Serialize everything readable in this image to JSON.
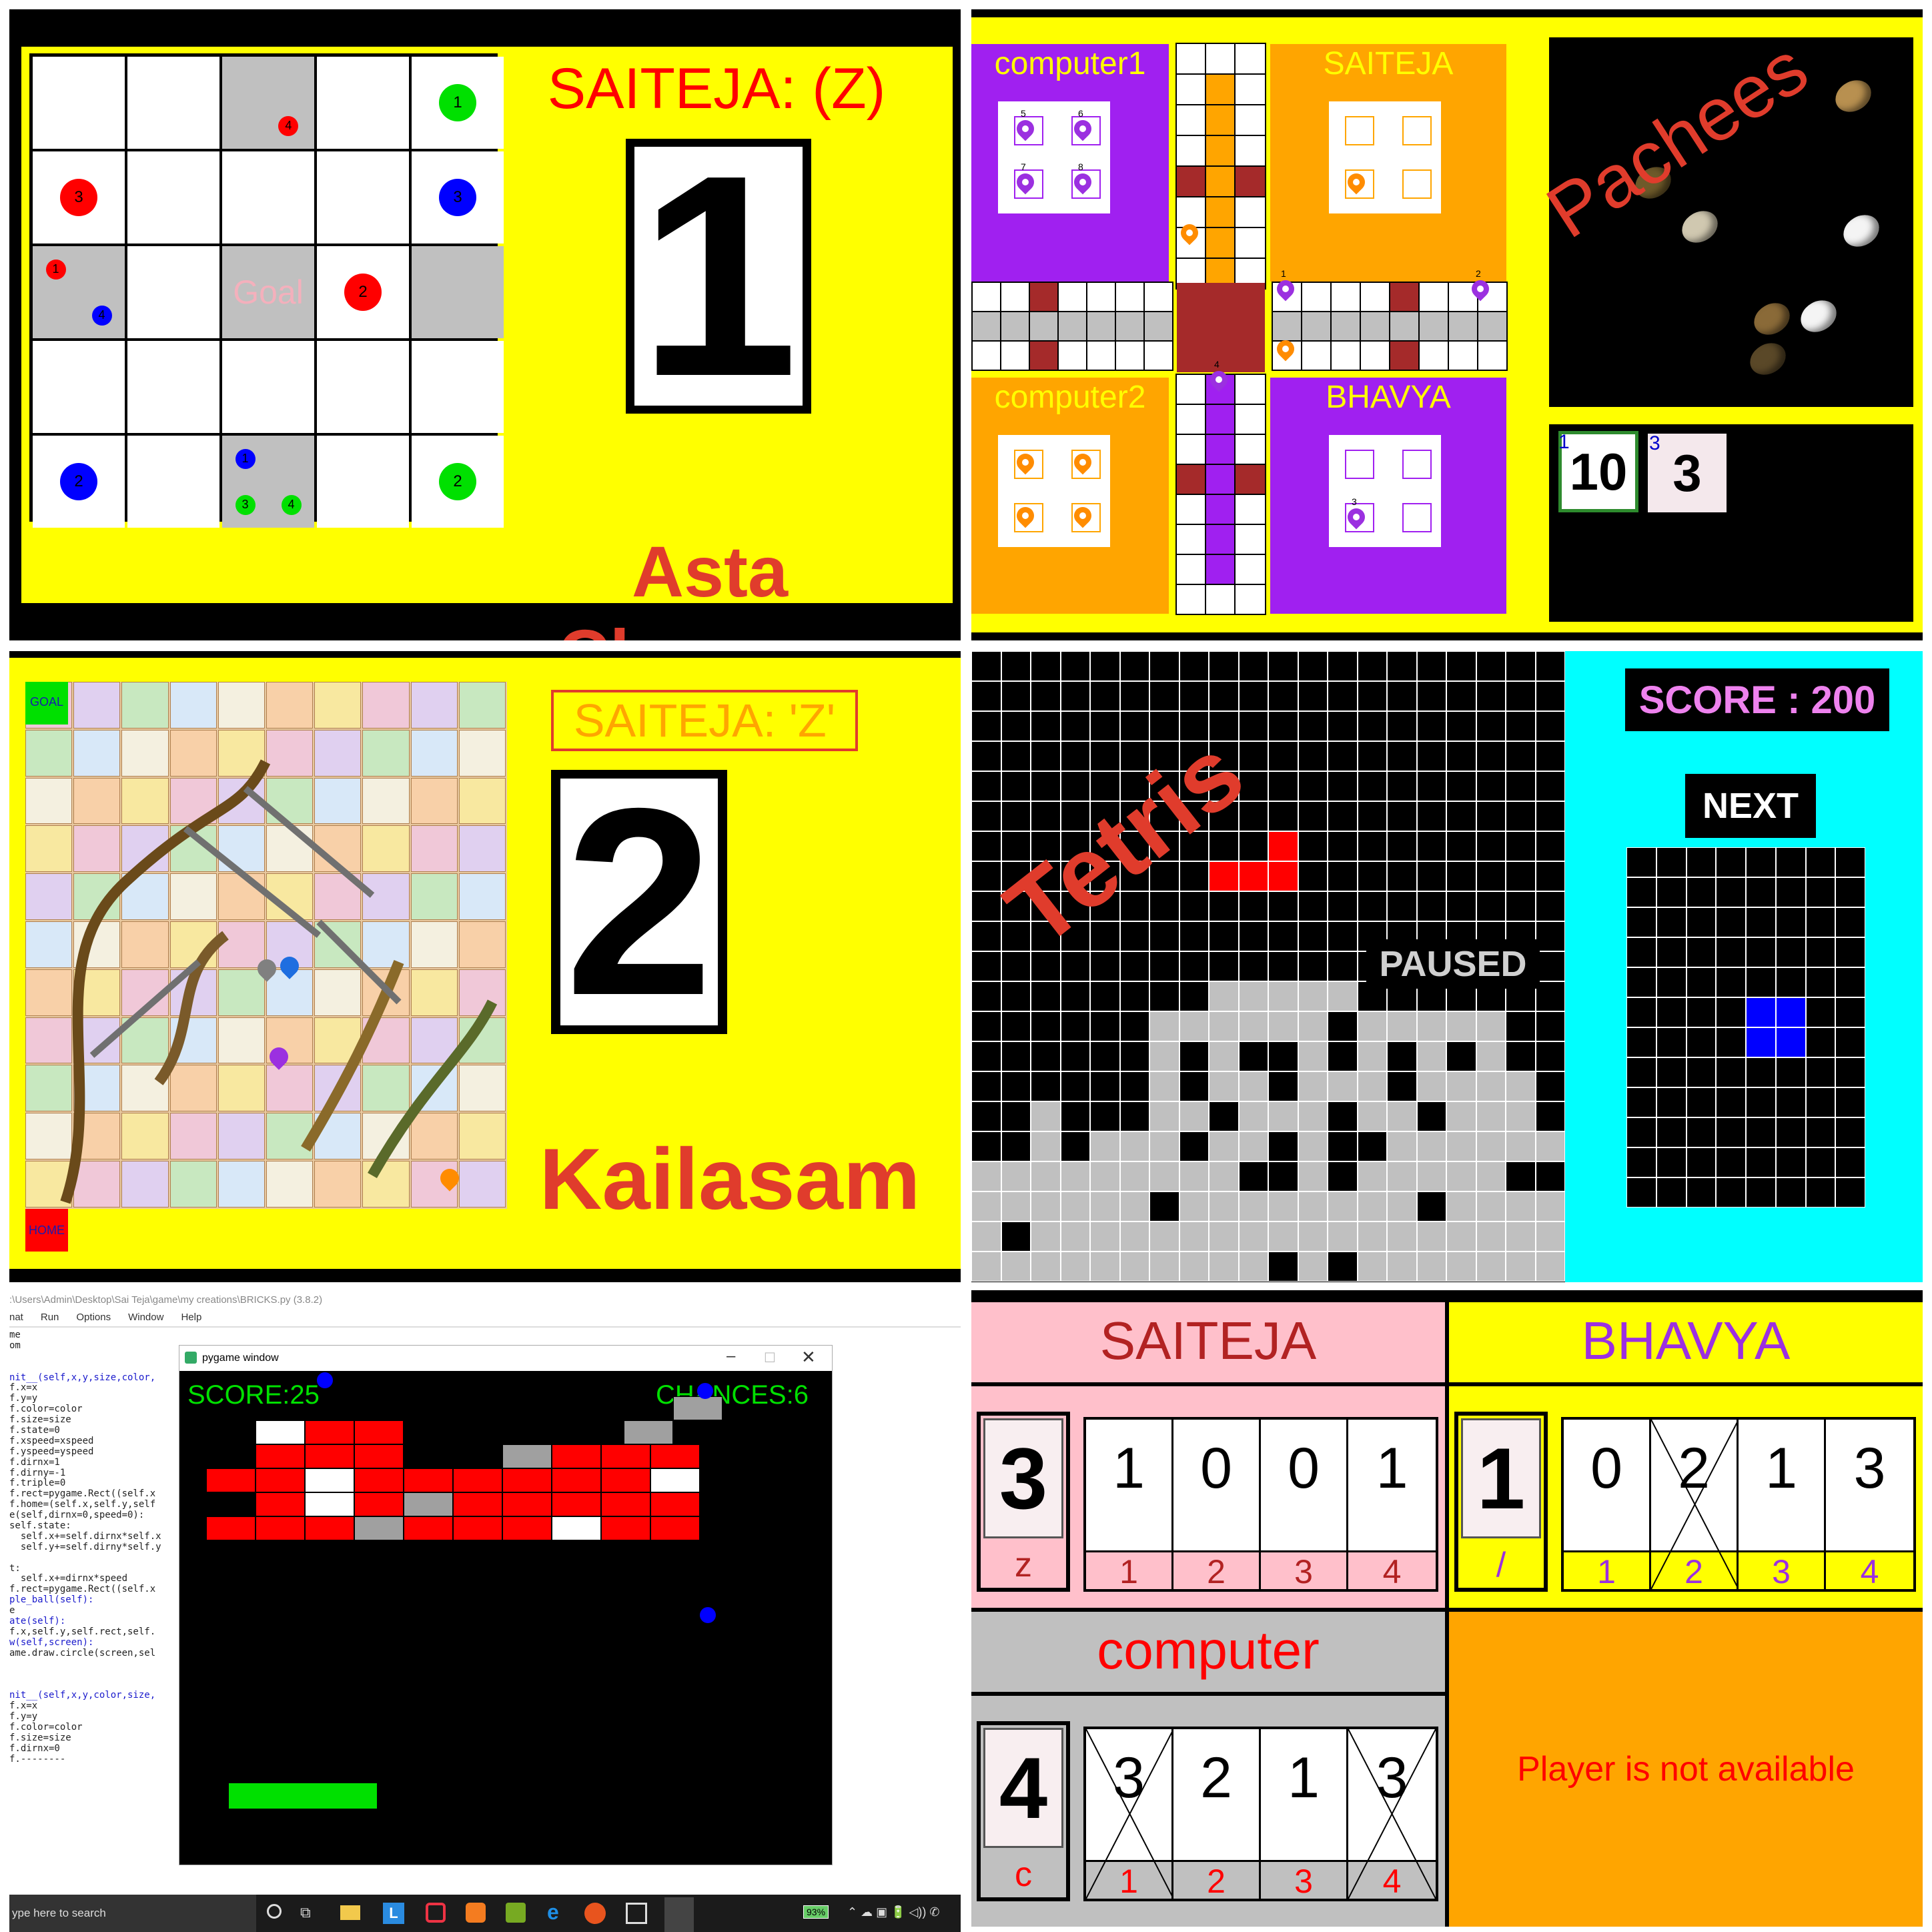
{
  "asta": {
    "title": "Asta Chamma",
    "player": "SAITEJA: (Z)",
    "dice": "1",
    "goal": "Goal",
    "pieces": [
      {
        "color": "#00e000",
        "label": "1",
        "row": 0,
        "col": 4,
        "fx": 0.5,
        "fy": 0.5,
        "size": "big"
      },
      {
        "color": "#ff0000",
        "label": "4",
        "row": 0,
        "col": 2,
        "fx": 0.72,
        "fy": 0.75,
        "size": "small"
      },
      {
        "color": "#ff0000",
        "label": "3",
        "row": 1,
        "col": 0,
        "fx": 0.5,
        "fy": 0.5,
        "size": "big"
      },
      {
        "color": "#0000ff",
        "label": "3",
        "row": 1,
        "col": 4,
        "fx": 0.5,
        "fy": 0.5,
        "size": "big"
      },
      {
        "color": "#ff0000",
        "label": "1",
        "row": 2,
        "col": 0,
        "fx": 0.25,
        "fy": 0.25,
        "size": "small"
      },
      {
        "color": "#0000ff",
        "label": "4",
        "row": 2,
        "col": 0,
        "fx": 0.75,
        "fy": 0.75,
        "size": "small"
      },
      {
        "color": "#ff0000",
        "label": "2",
        "row": 2,
        "col": 3,
        "fx": 0.5,
        "fy": 0.5,
        "size": "big"
      },
      {
        "color": "#0000ff",
        "label": "2",
        "row": 4,
        "col": 0,
        "fx": 0.5,
        "fy": 0.5,
        "size": "big"
      },
      {
        "color": "#0000ff",
        "label": "1",
        "row": 4,
        "col": 2,
        "fx": 0.25,
        "fy": 0.25,
        "size": "small"
      },
      {
        "color": "#00e000",
        "label": "3",
        "row": 4,
        "col": 2,
        "fx": 0.25,
        "fy": 0.75,
        "size": "small"
      },
      {
        "color": "#00e000",
        "label": "4",
        "row": 4,
        "col": 2,
        "fx": 0.75,
        "fy": 0.75,
        "size": "small"
      },
      {
        "color": "#00e000",
        "label": "2",
        "row": 4,
        "col": 4,
        "fx": 0.5,
        "fy": 0.5,
        "size": "big"
      }
    ]
  },
  "pachees": {
    "title": "Pachees",
    "computer1": "computer1",
    "computer2": "computer2",
    "saiteja": "SAITEJA",
    "bhavya": "BHAVYA",
    "c1_labels": [
      "5",
      "6",
      "7",
      "8"
    ],
    "bhavya_label": "3",
    "board_marker_labels": [
      "1",
      "2",
      "4"
    ],
    "score1_small": "1",
    "score1": "10",
    "score2_small": "3",
    "score2": "3"
  },
  "kailasam": {
    "title": "Kailasam",
    "player": "SAITEJA: 'Z'",
    "dice": "2",
    "goal": "GOAL",
    "home": "HOME"
  },
  "tetris": {
    "title": "Tetris",
    "score": "SCORE : 200",
    "next": "NEXT",
    "paused": "PAUSED"
  },
  "bricks": {
    "path": ":\\Users\\Admin\\Desktop\\Sai Teja\\game\\my creations\\BRICKS.py (3.8.2)",
    "menu": [
      "nat",
      "Run",
      "Options",
      "Window",
      "Help"
    ],
    "window_title": "pygame window",
    "score": "SCORE:25",
    "chances": "CHANCES:6",
    "taskbar_search": "ype here to search",
    "battery": "93%",
    "code_lines": [
      "me",
      "om",
      "",
      "",
      "nit__(self,x,y,size,color,",
      "f.x=x",
      "f.y=y",
      "f.color=color",
      "f.size=size",
      "f.state=0",
      "f.xspeed=xspeed",
      "f.yspeed=yspeed",
      "f.dirnx=1",
      "f.dirny=-1",
      "f.triple=0",
      "f.rect=pygame.Rect((self.x",
      "f.home=(self.x,self.y,self",
      "e(self,dirnx=0,speed=0):",
      "self.state:",
      "  self.x+=self.dirnx*self.x",
      "  self.y+=self.dirny*self.y",
      "",
      "t:",
      "  self.x+=dirnx*speed",
      "f.rect=pygame.Rect((self.x",
      "ple_ball(self):",
      "e",
      "ate(self):",
      "f.x,self.y,self.rect,self.",
      "w(self,screen):",
      "ame.draw.circle(screen,sel",
      "",
      "",
      "",
      "nit__(self,x,y,color,size,",
      "f.x=x",
      "f.y=y",
      "f.color=color",
      "f.size=size",
      "f.dirnx=0",
      "f.--------"
    ]
  },
  "scores": {
    "p1": {
      "name": "SAITEJA",
      "key": "z",
      "dice": "3",
      "digits": [
        "1",
        "0",
        "0",
        "1"
      ],
      "crossed": [
        false,
        false,
        false,
        false
      ],
      "idx": [
        "1",
        "2",
        "3",
        "4"
      ]
    },
    "p2": {
      "name": "BHAVYA",
      "key": "/",
      "dice": "1",
      "digits": [
        "0",
        "2",
        "1",
        "3"
      ],
      "crossed": [
        false,
        true,
        false,
        false
      ],
      "idx": [
        "1",
        "2",
        "3",
        "4"
      ]
    },
    "p3": {
      "name": "computer",
      "key": "c",
      "dice": "4",
      "digits": [
        "3",
        "2",
        "1",
        "3"
      ],
      "crossed": [
        true,
        false,
        false,
        true
      ],
      "idx": [
        "1",
        "2",
        "3",
        "4"
      ]
    },
    "na": "Player is not available"
  }
}
